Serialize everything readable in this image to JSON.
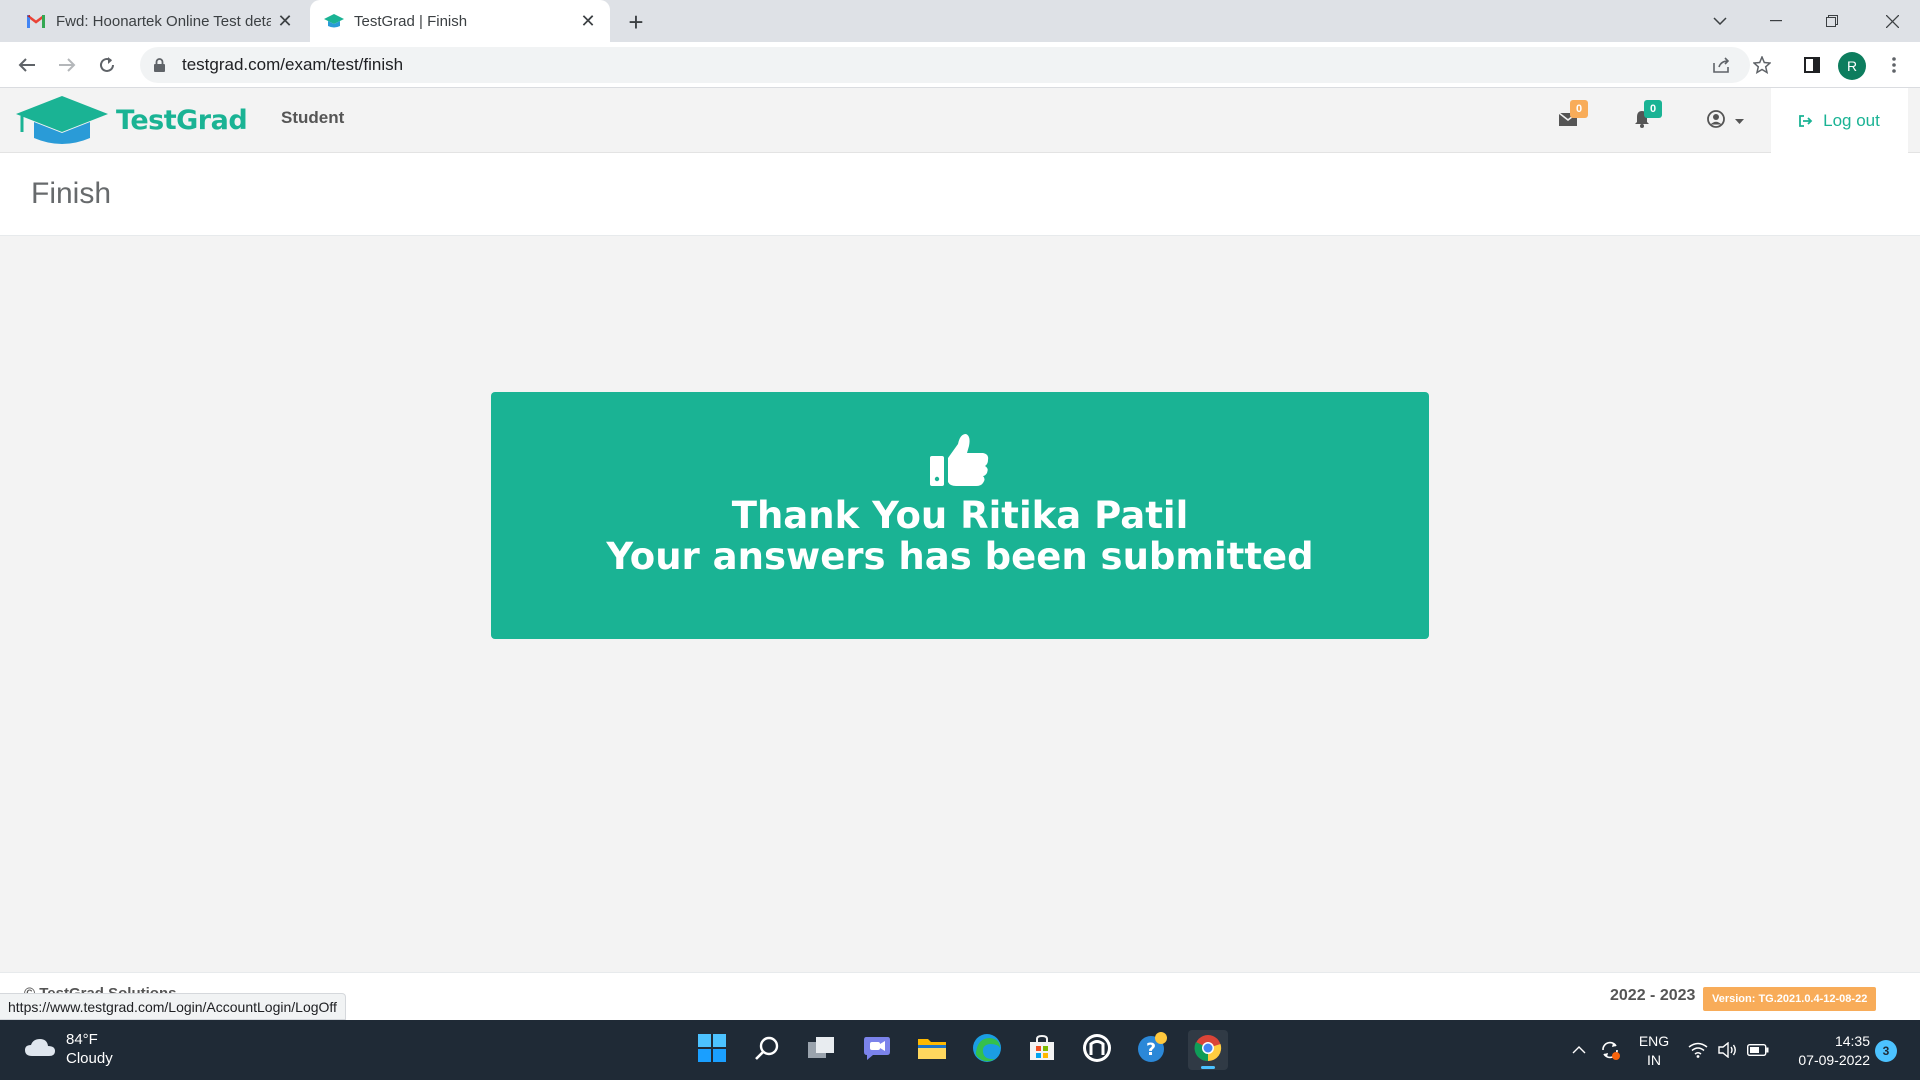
{
  "browser": {
    "tabs": [
      {
        "title": "Fwd: Hoonartek Online Test deta",
        "icon": "gmail-icon",
        "active": false
      },
      {
        "title": "TestGrad | Finish",
        "icon": "testgrad-icon",
        "active": true
      }
    ],
    "url": "testgrad.com/exam/test/finish",
    "profile_initial": "R",
    "status_url": "https://www.testgrad.com/Login/AccountLogin/LogOff"
  },
  "app": {
    "logo_text": "TestGrad",
    "nav_student": "Student",
    "mail_count": "0",
    "notification_count": "0",
    "logout_label": "Log out",
    "colors": {
      "brand": "#1ab394",
      "mail_badge": "#f8ac59",
      "notif_badge": "#1ab394"
    }
  },
  "page": {
    "title": "Finish"
  },
  "finish": {
    "line1": "Thank You Ritika Patil",
    "line2": "Your answers has been submitted"
  },
  "footer": {
    "copyright": "© TestGrad Solutions",
    "years": "2022 - 2023",
    "version": "Version: TG.2021.0.4-12-08-22"
  },
  "taskbar": {
    "temperature": "84°F",
    "condition": "Cloudy",
    "lang_line1": "ENG",
    "lang_line2": "IN",
    "time": "14:35",
    "date": "07-09-2022",
    "notification_count": "3"
  }
}
